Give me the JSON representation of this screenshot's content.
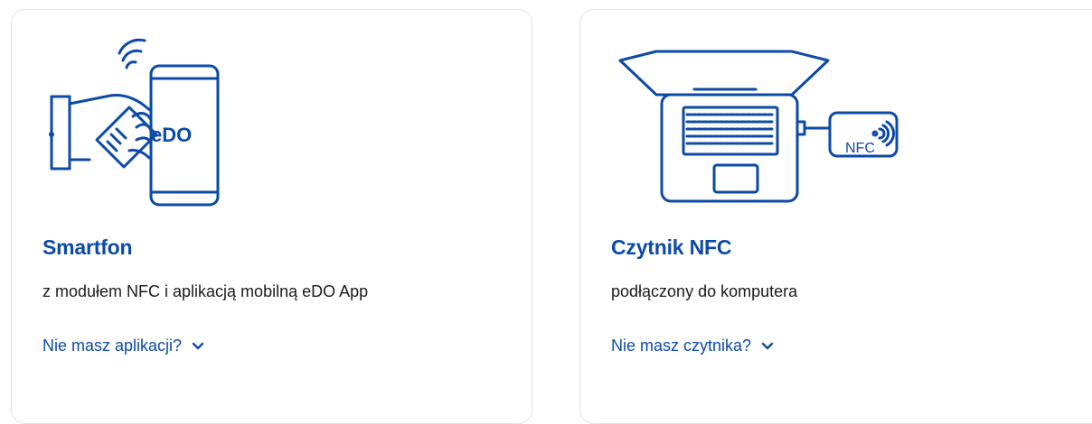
{
  "cards": [
    {
      "title": "Smartfon",
      "description": "z modułem NFC i aplikacją mobilną eDO App",
      "toggle_label": "Nie masz aplikacji?",
      "phone_label": "eDO"
    },
    {
      "title": "Czytnik NFC",
      "description": "podłączony do komputera",
      "toggle_label": "Nie masz czytnika?",
      "reader_label": "NFC"
    }
  ],
  "colors": {
    "accent": "#0c4aa8",
    "text": "#1b1b1b",
    "border": "#dfe3ea"
  },
  "icons": [
    "smartphone-nfc-illustration",
    "laptop-nfc-reader-illustration",
    "chevron-down-icon"
  ]
}
